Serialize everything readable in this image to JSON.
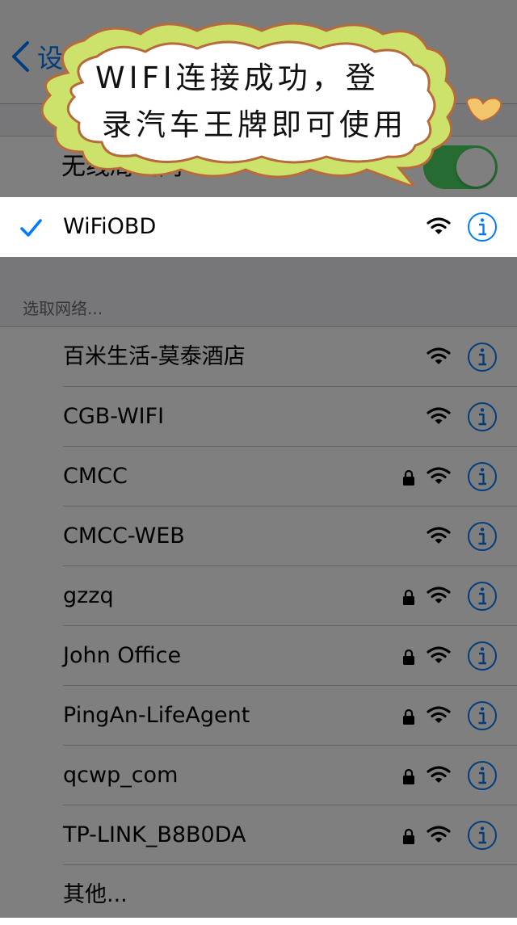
{
  "nav": {
    "back_label": "设"
  },
  "wifi_toggle": {
    "label": "无线局域网",
    "state": "on",
    "accent_color": "#4cd964"
  },
  "connected_network": {
    "name": "WiFiOBD",
    "icon": "checkmark-icon",
    "locked": false
  },
  "section": {
    "header": "选取网络..."
  },
  "networks": [
    {
      "name": "百米生活-莫泰酒店",
      "locked": false
    },
    {
      "name": "CGB-WIFI",
      "locked": false
    },
    {
      "name": "CMCC",
      "locked": true
    },
    {
      "name": "CMCC-WEB",
      "locked": false
    },
    {
      "name": "gzzq",
      "locked": true
    },
    {
      "name": "John Office",
      "locked": true
    },
    {
      "name": "PingAn-LifeAgent",
      "locked": true
    },
    {
      "name": "qcwp_com",
      "locked": true
    },
    {
      "name": "TP-LINK_B8B0DA",
      "locked": true
    }
  ],
  "other": {
    "label": "其他..."
  },
  "callout": {
    "line1": "WIFI连接成功，登",
    "line2": "录汽车王牌即可使用"
  },
  "colors": {
    "ios_blue": "#007aff",
    "bubble_green": "#cde26a",
    "bubble_outline": "#b76a3c",
    "heart": "#f2c56b"
  }
}
